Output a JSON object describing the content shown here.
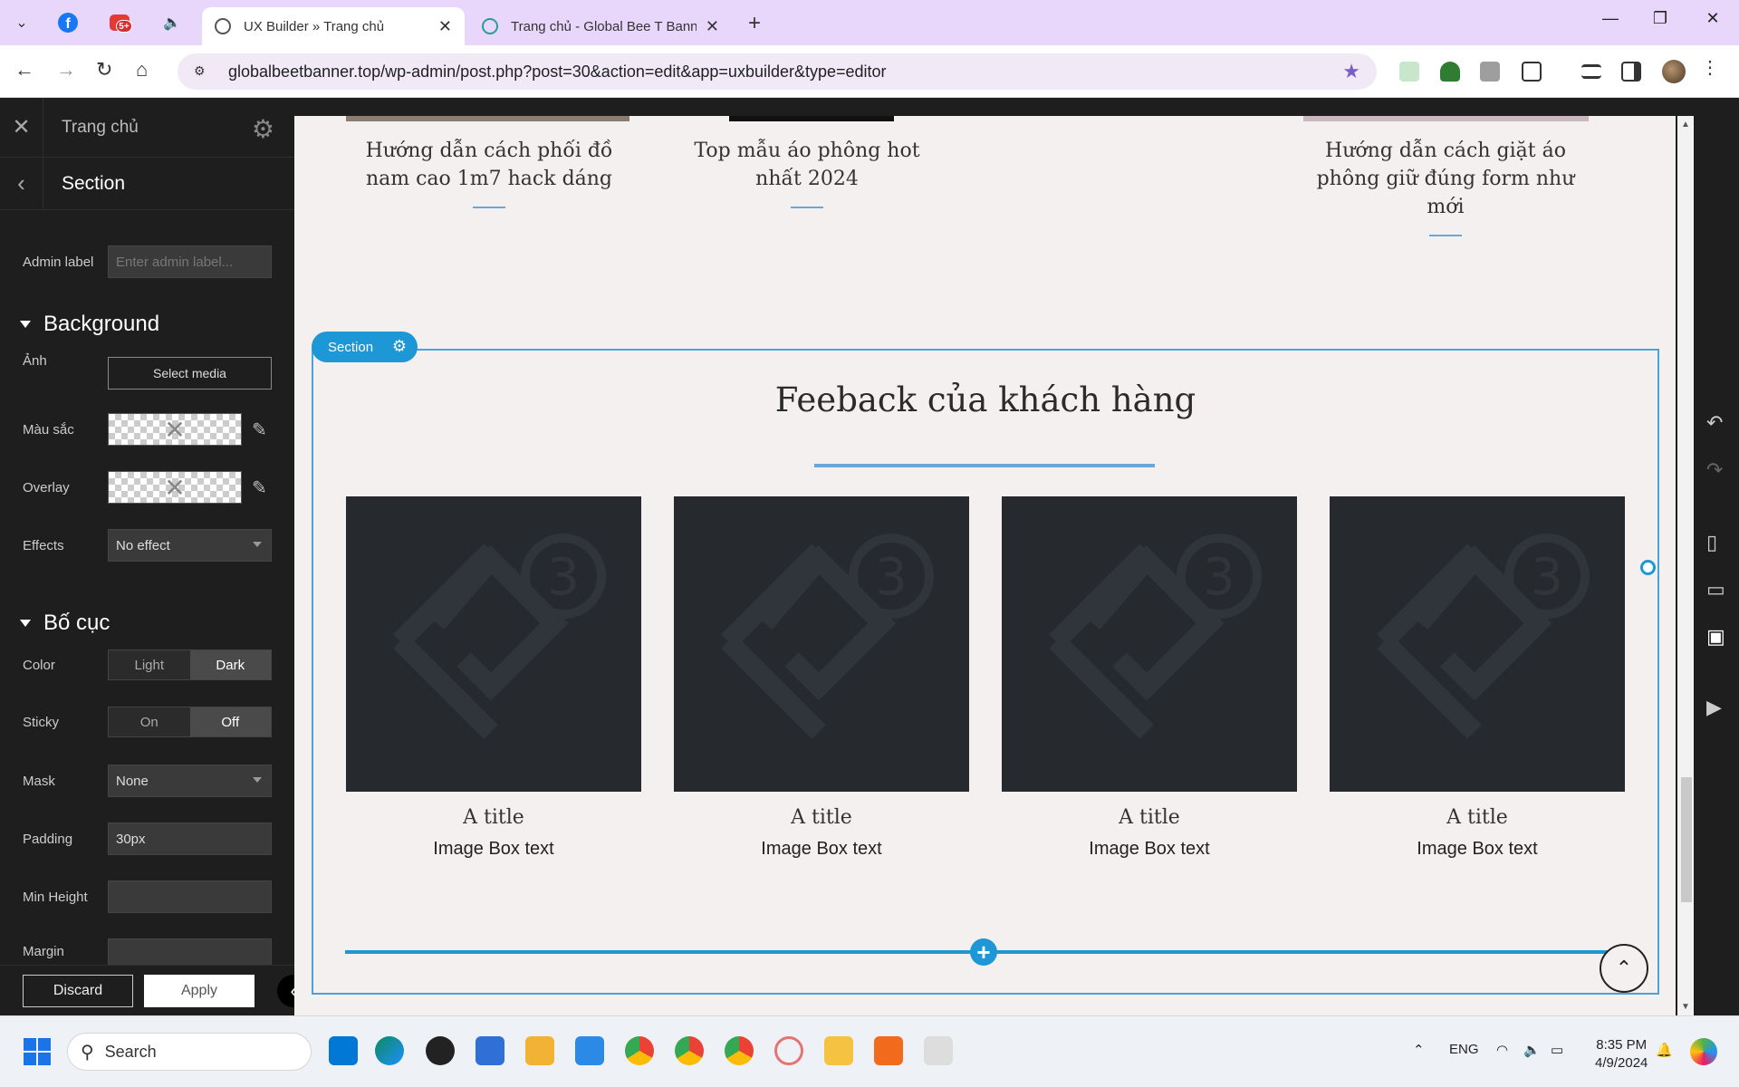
{
  "browser": {
    "tabs": [
      {
        "title": "UX Builder » Trang chủ",
        "active": true
      },
      {
        "title": "Trang chủ - Global Bee T Banne",
        "active": false
      }
    ],
    "url": "globalbeetbanner.top/wp-admin/post.php?post=30&action=edit&app=uxbuilder&type=editor",
    "yt_badge": "5+",
    "fb_letter": "f"
  },
  "panel": {
    "page_title": "Trang chủ",
    "section_title": "Section",
    "admin_label": {
      "label": "Admin label",
      "placeholder": "Enter admin label..."
    },
    "background": {
      "heading": "Background",
      "image_label": "Ảnh",
      "select_media": "Select media",
      "color_label": "Màu sắc",
      "overlay_label": "Overlay",
      "effects_label": "Effects",
      "effects_value": "No effect"
    },
    "layout": {
      "heading": "Bố cục",
      "color_label": "Color",
      "color_options": [
        "Light",
        "Dark"
      ],
      "color_selected": "Dark",
      "sticky_label": "Sticky",
      "sticky_options": [
        "On",
        "Off"
      ],
      "sticky_selected": "Off",
      "mask_label": "Mask",
      "mask_value": "None",
      "padding_label": "Padding",
      "padding_value": "30px",
      "min_height_label": "Min Height",
      "min_height_value": "",
      "margin_label": "Margin",
      "margin_value": ""
    },
    "discard": "Discard",
    "apply": "Apply"
  },
  "canvas": {
    "posts": [
      {
        "title_line1": "Hướng dẫn cách phối đồ",
        "title_line2": "nam cao 1m7 hack dáng",
        "title_line3": ""
      },
      {
        "title_line1": "Top mẫu áo phông hot",
        "title_line2": "nhất 2024",
        "title_line3": ""
      },
      {
        "title_line1": "Hướng dẫn cách giặt áo",
        "title_line2": "phông giữ đúng form như",
        "title_line3": "mới"
      }
    ],
    "section_tag": "Section",
    "feedback_heading": "Feeback của khách hàng",
    "image_boxes": [
      {
        "title": "A title",
        "text": "Image Box text"
      },
      {
        "title": "A title",
        "text": "Image Box text"
      },
      {
        "title": "A title",
        "text": "Image Box text"
      },
      {
        "title": "A title",
        "text": "Image Box text"
      }
    ]
  },
  "taskbar": {
    "search_placeholder": "Search",
    "language": "ENG",
    "time": "8:35 PM",
    "date": "4/9/2024"
  },
  "colors": {
    "accent": "#1e97d6",
    "panel_bg": "#1e1e1e",
    "canvas_bg": "#f5f0f0",
    "image_placeholder": "#262a2f"
  }
}
